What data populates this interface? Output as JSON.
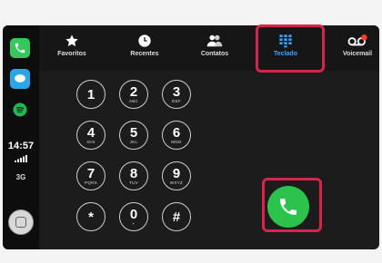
{
  "status": {
    "time": "14:57",
    "network": "3G"
  },
  "tabs": [
    {
      "label": "Favoritos",
      "icon": "star-icon"
    },
    {
      "label": "Recentes",
      "icon": "clock-icon"
    },
    {
      "label": "Contatos",
      "icon": "contacts-icon"
    },
    {
      "label": "Teclado",
      "icon": "keypad-icon",
      "active": true
    },
    {
      "label": "Voicemail",
      "icon": "voicemail-icon"
    }
  ],
  "keypad": {
    "keys": [
      {
        "digit": "1",
        "letters": ""
      },
      {
        "digit": "2",
        "letters": "ABC"
      },
      {
        "digit": "3",
        "letters": "DEF"
      },
      {
        "digit": "4",
        "letters": "GHI"
      },
      {
        "digit": "5",
        "letters": "JKL"
      },
      {
        "digit": "6",
        "letters": "MNO"
      },
      {
        "digit": "7",
        "letters": "PQRS"
      },
      {
        "digit": "8",
        "letters": "TUV"
      },
      {
        "digit": "9",
        "letters": "WXYZ"
      },
      {
        "digit": "*",
        "letters": ""
      },
      {
        "digit": "0",
        "letters": "+"
      },
      {
        "digit": "#",
        "letters": ""
      }
    ]
  },
  "colors": {
    "highlight": "#d8234a",
    "call_green": "#2cc34d",
    "active_tab": "#3fa2ff"
  }
}
